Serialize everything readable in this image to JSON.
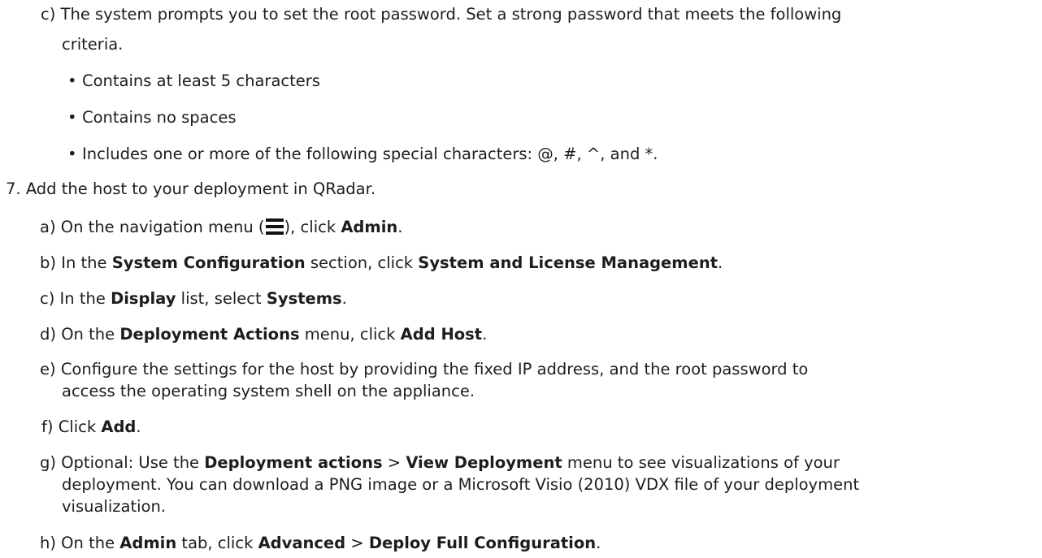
{
  "step6c": {
    "label": "c)",
    "text_line1": "The system prompts you to set the root password. Set a strong password that meets the following",
    "text_line2": "criteria.",
    "bullets": [
      "Contains at least 5 characters",
      "Contains no spaces",
      "Includes one or more of the following special characters: @, #, ^, and *."
    ]
  },
  "step7": {
    "label": "7.",
    "text": "Add the host to your deployment in QRadar.",
    "substeps": [
      {
        "label": "a)",
        "pre": "On the navigation menu (",
        "icon": "navigation-menu-icon",
        "mid": "), click ",
        "b1": "Admin",
        "post": "."
      },
      {
        "label": "b)",
        "pre": "In the ",
        "b1": "System Configuration",
        "mid": " section, click ",
        "b2": "System and License Management",
        "post": "."
      },
      {
        "label": "c)",
        "pre": "In the ",
        "b1": "Display",
        "mid": " list, select ",
        "b2": "Systems",
        "post": "."
      },
      {
        "label": "d)",
        "pre": "On the ",
        "b1": "Deployment Actions",
        "mid": " menu, click ",
        "b2": "Add Host",
        "post": "."
      },
      {
        "label": "e)",
        "line1": "Configure the settings for the host by providing the fixed IP address, and the root password to",
        "line2": "access the operating system shell on the appliance."
      },
      {
        "label": "f)",
        "pre": "Click ",
        "b1": "Add",
        "post": "."
      },
      {
        "label": "g)",
        "pre": "Optional: Use the ",
        "b1": "Deployment actions",
        "mid": " > ",
        "b2": "View Deployment",
        "post": " menu to see visualizations of your",
        "line2": "deployment. You can download a PNG image or a Microsoft Visio (2010) VDX file of your deployment",
        "line3": "visualization."
      },
      {
        "label": "h)",
        "pre": "On the ",
        "b1": "Admin",
        "mid": " tab, click ",
        "b2": "Advanced",
        "mid2": " > ",
        "b3": "Deploy Full Configuration",
        "post": "."
      }
    ]
  }
}
